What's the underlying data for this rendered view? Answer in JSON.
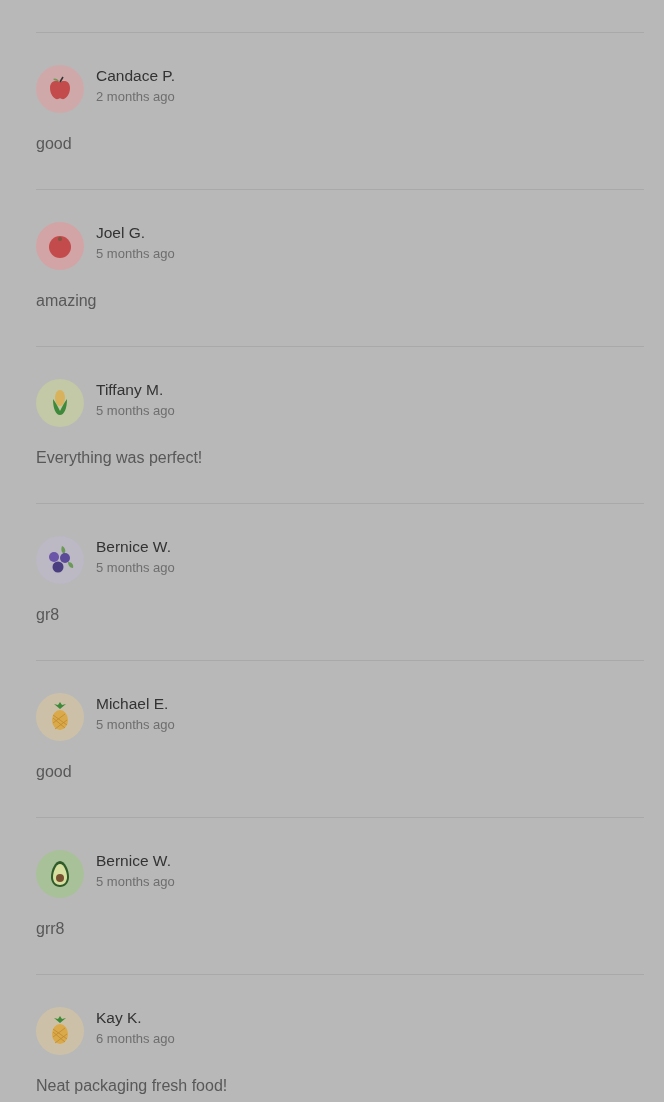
{
  "reviews": [
    {
      "name": "Candace P.",
      "time": "2 months ago",
      "comment": "good",
      "kind": "apple"
    },
    {
      "name": "Joel G.",
      "time": "5 months ago",
      "comment": "amazing",
      "kind": "tomato"
    },
    {
      "name": "Tiffany M.",
      "time": "5 months ago",
      "comment": "Everything was perfect!",
      "kind": "corn"
    },
    {
      "name": "Bernice W.",
      "time": "5 months ago",
      "comment": "gr8",
      "kind": "blueberry"
    },
    {
      "name": "Michael E.",
      "time": "5 months ago",
      "comment": "good",
      "kind": "pineapple"
    },
    {
      "name": "Bernice W.",
      "time": "5 months ago",
      "comment": "grr8",
      "kind": "avocado"
    },
    {
      "name": "Kay K.",
      "time": "6 months ago",
      "comment": "Neat packaging fresh food!",
      "kind": "pineapple"
    }
  ]
}
